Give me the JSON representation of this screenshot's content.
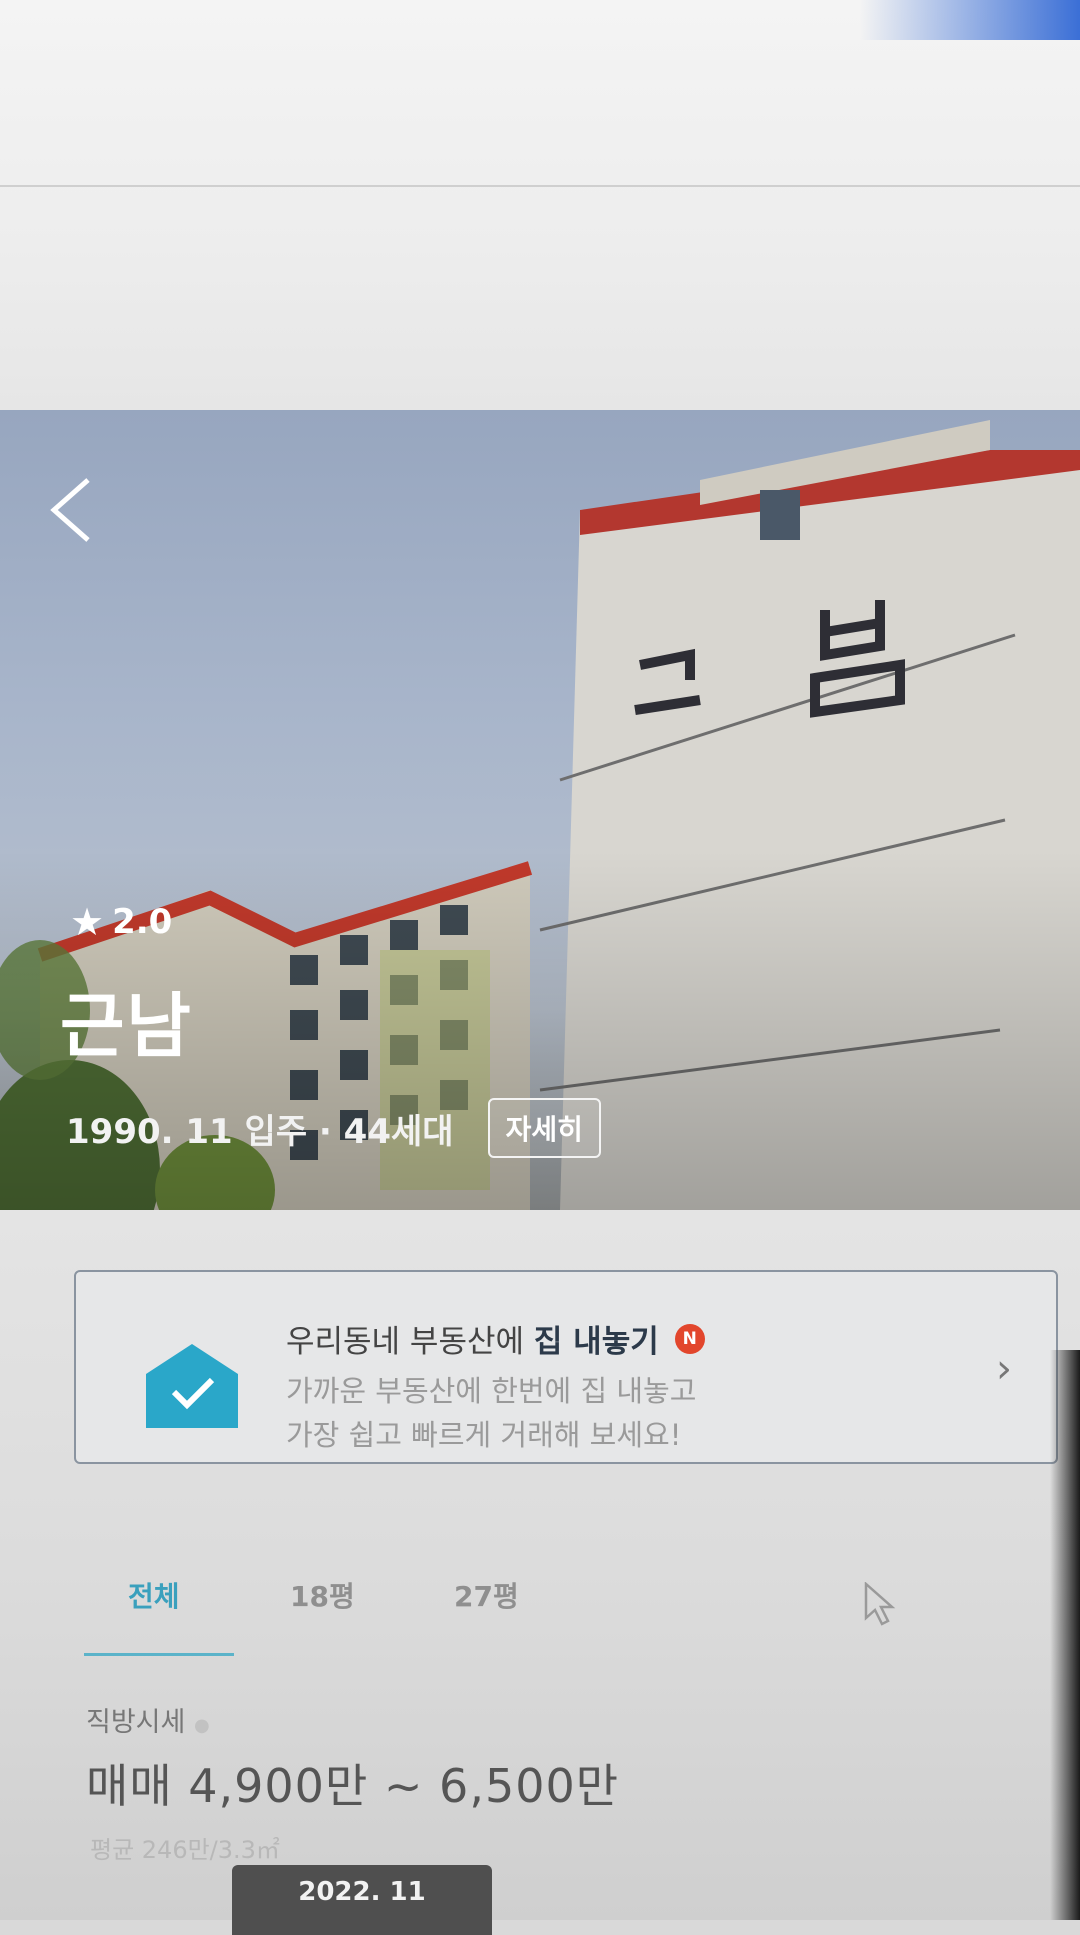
{
  "hero": {
    "back_label": "back",
    "rating": "2.0",
    "apartment_name": "근남",
    "info": "1990. 11 입주 · 44세대",
    "detail_button": "자세히"
  },
  "promo": {
    "title_prefix": "우리동네 부동산에",
    "title_bold": "집 내놓기",
    "badge": "N",
    "line1": "가까운 부동산에 한번에 집 내놓고",
    "line2": "가장 쉽고 빠르게 거래해 보세요!"
  },
  "tabs": [
    {
      "label": "전체",
      "active": true
    },
    {
      "label": "18평",
      "active": false
    },
    {
      "label": "27평",
      "active": false
    }
  ],
  "price": {
    "label": "직방시세",
    "range": "매매 4,900만 ~ 6,500만",
    "average": "평균 246만/3.3㎡",
    "date": "2022. 11"
  },
  "colors": {
    "accent": "#3aa0bd",
    "promo_icon": "#2aa7c9",
    "badge": "#e2462c"
  }
}
